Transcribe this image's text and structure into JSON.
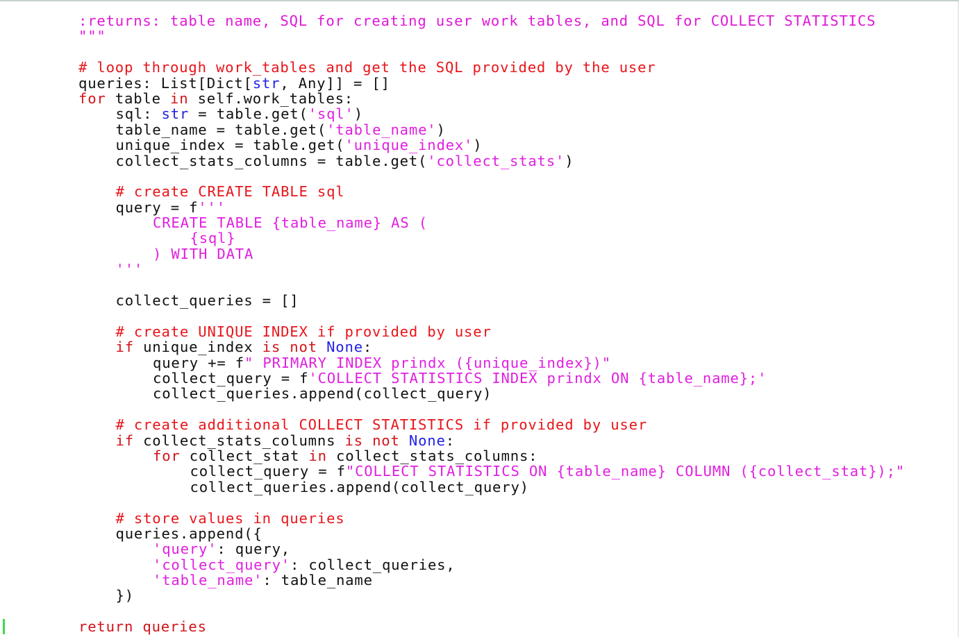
{
  "docstring": {
    "returns_line": ":returns: table name, SQL for creating user work tables, and SQL for COLLECT STATISTICS",
    "close": "\"\"\""
  },
  "block1": {
    "comment": "# loop through work_tables and get the SQL provided by the user",
    "queries_pre": "queries: List[Dict[",
    "queries_str": "str",
    "queries_post": ", Any]] = []",
    "for_kw": "for",
    "for_mid": " table ",
    "in_kw": "in",
    "for_post": " self.work_tables:",
    "sql_pre": "sql: ",
    "sql_type": "str",
    "sql_mid": " = table.get(",
    "sql_key": "'sql'",
    "sql_end": ")",
    "tn_pre": "table_name = table.get(",
    "tn_key": "'table_name'",
    "tn_end": ")",
    "ui_pre": "unique_index = table.get(",
    "ui_key": "'unique_index'",
    "ui_end": ")",
    "cs_pre": "collect_stats_columns = table.get(",
    "cs_key": "'collect_stats'",
    "cs_end": ")"
  },
  "block2": {
    "comment": "# create CREATE TABLE sql",
    "query_pre": "query = f",
    "query_open": "'''",
    "create_line": "CREATE TABLE {table_name} AS (",
    "sql_line": "{sql}",
    "with_line": ") WITH DATA",
    "close": "'''"
  },
  "block3": {
    "collect_init": "collect_queries = []"
  },
  "block4": {
    "comment": "# create UNIQUE INDEX if provided by user",
    "if_kw": "if",
    "if_mid": " unique_index ",
    "is_kw": "is",
    "sp": " ",
    "not_kw": "not",
    "none_kw": "None",
    "colon": ":",
    "q_pre": "query += f",
    "q_str": "\" PRIMARY INDEX prindx ({unique_index})\"",
    "cq_pre": "collect_query = f",
    "cq_str": "'COLLECT STATISTICS INDEX prindx ON {table_name};'",
    "append_line": "collect_queries.append(collect_query)"
  },
  "block5": {
    "comment": "# create additional COLLECT STATISTICS if provided by user",
    "if_kw": "if",
    "if_mid": " collect_stats_columns ",
    "is_kw": "is",
    "sp": " ",
    "not_kw": "not",
    "none_kw": "None",
    "colon": ":",
    "for_kw": "for",
    "for_mid": " collect_stat ",
    "in_kw": "in",
    "for_post": " collect_stats_columns:",
    "cq_pre": "collect_query = f",
    "cq_str": "\"COLLECT STATISTICS ON {table_name} COLUMN ({collect_stat});\"",
    "append_line": "collect_queries.append(collect_query)"
  },
  "block6": {
    "comment": "# store values in queries",
    "append_open": "queries.append({",
    "k_query": "'query'",
    "v_query": ": query,",
    "k_collect": "'collect_query'",
    "v_collect": ": collect_queries,",
    "k_table": "'table_name'",
    "v_table": ": table_name",
    "append_close": "})"
  },
  "return_line": "return queries"
}
